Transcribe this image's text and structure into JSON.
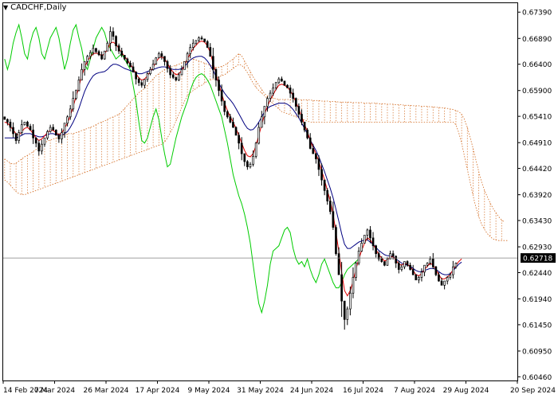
{
  "header": {
    "symbol_label": "CADCHF,Daily"
  },
  "colors": {
    "background": "#ffffff",
    "frame": "#000000",
    "bull_candle": "#ffffff",
    "bear_candle": "#000000",
    "tenkan": "#e00000",
    "kijun": "#000080",
    "chikou": "#00cc00",
    "kumo": "#d2691e",
    "current_price_line": "#808080",
    "price_box_bg": "#000000",
    "price_box_text": "#ffffff"
  },
  "chart_data": {
    "type": "candlestick",
    "instrument": "CADCHF",
    "timeframe": "Daily",
    "indicator": "Ichimoku Kinko Hyo",
    "current_price": 0.62718,
    "current_price_label": "0.62718",
    "ylim": [
      0.6039,
      0.6756
    ],
    "y_ticks": [
      "0.67390",
      "0.66890",
      "0.66400",
      "0.65900",
      "0.65410",
      "0.64910",
      "0.64420",
      "0.63920",
      "0.63430",
      "0.62930",
      "0.62440",
      "0.61940",
      "0.61450",
      "0.60950",
      "0.60460"
    ],
    "x_ticks": [
      "14 Feb 2024",
      "7 Mar 2024",
      "26 Mar 2024",
      "17 Apr 2024",
      "9 May 2024",
      "31 May 2024",
      "24 Jun 2024",
      "16 Jul 2024",
      "7 Aug 2024",
      "29 Aug 2024",
      "20 Sep 2024"
    ],
    "num_bars": 159,
    "num_slots": 180,
    "close": [
      0.6535,
      0.653,
      0.652,
      0.6508,
      0.6495,
      0.651,
      0.6525,
      0.653,
      0.6522,
      0.6515,
      0.65,
      0.649,
      0.6475,
      0.6488,
      0.65,
      0.6512,
      0.652,
      0.6515,
      0.6505,
      0.6498,
      0.651,
      0.6528,
      0.654,
      0.6555,
      0.6575,
      0.659,
      0.661,
      0.663,
      0.6645,
      0.6655,
      0.6662,
      0.667,
      0.6664,
      0.6658,
      0.665,
      0.6665,
      0.668,
      0.6702,
      0.6693,
      0.6675,
      0.6665,
      0.6657,
      0.665,
      0.6642,
      0.6635,
      0.6625,
      0.6612,
      0.6605,
      0.66,
      0.6611,
      0.6622,
      0.663,
      0.664,
      0.6652,
      0.666,
      0.6655,
      0.6645,
      0.6632,
      0.662,
      0.6615,
      0.661,
      0.662,
      0.663,
      0.6645,
      0.666,
      0.6672,
      0.668,
      0.6685,
      0.669,
      0.6688,
      0.6683,
      0.6672,
      0.6655,
      0.663,
      0.661,
      0.659,
      0.657,
      0.655,
      0.654,
      0.653,
      0.652,
      0.6505,
      0.649,
      0.647,
      0.6455,
      0.6445,
      0.645,
      0.6465,
      0.649,
      0.652,
      0.654,
      0.656,
      0.6575,
      0.6585,
      0.6595,
      0.6605,
      0.6612,
      0.6608,
      0.66,
      0.6595,
      0.6585,
      0.6575,
      0.656,
      0.6545,
      0.653,
      0.6515,
      0.65,
      0.648,
      0.647,
      0.646,
      0.644,
      0.642,
      0.64,
      0.638,
      0.636,
      0.633,
      0.628,
      0.624,
      0.619,
      0.6155,
      0.6175,
      0.6205,
      0.6235,
      0.6262,
      0.6285,
      0.63,
      0.6315,
      0.6325,
      0.631,
      0.6295,
      0.628,
      0.627,
      0.6265,
      0.6258,
      0.627,
      0.628,
      0.6275,
      0.6262,
      0.625,
      0.6255,
      0.6265,
      0.6258,
      0.625,
      0.624,
      0.623,
      0.6235,
      0.6245,
      0.6258,
      0.6262,
      0.627,
      0.6255,
      0.624,
      0.6228,
      0.622,
      0.6228,
      0.6235,
      0.624,
      0.6255,
      0.6262,
      0.627,
      0.6272
    ],
    "open_offset": 1,
    "tenkan": [
      0.653,
      0.6528,
      0.6522,
      0.6515,
      0.6508,
      0.6505,
      0.6512,
      0.6518,
      0.652,
      0.6515,
      0.6508,
      0.65,
      0.6495,
      0.6498,
      0.6504,
      0.651,
      0.6515,
      0.6514,
      0.651,
      0.6506,
      0.651,
      0.6518,
      0.6528,
      0.6542,
      0.656,
      0.6578,
      0.6598,
      0.6618,
      0.6634,
      0.6646,
      0.6654,
      0.666,
      0.6661,
      0.666,
      0.6656,
      0.666,
      0.6668,
      0.668,
      0.6682,
      0.6678,
      0.667,
      0.6662,
      0.6655,
      0.6648,
      0.664,
      0.6632,
      0.6622,
      0.6614,
      0.661,
      0.6612,
      0.6618,
      0.6626,
      0.6634,
      0.6644,
      0.6652,
      0.6654,
      0.665,
      0.6642,
      0.6632,
      0.6625,
      0.662,
      0.6622,
      0.6628,
      0.6638,
      0.665,
      0.666,
      0.667,
      0.6676,
      0.6682,
      0.6684,
      0.6682,
      0.6675,
      0.6662,
      0.6642,
      0.6622,
      0.6602,
      0.6584,
      0.6566,
      0.6552,
      0.654,
      0.653,
      0.6518,
      0.6505,
      0.649,
      0.6476,
      0.6466,
      0.6464,
      0.647,
      0.6485,
      0.6505,
      0.6525,
      0.6545,
      0.656,
      0.6572,
      0.6582,
      0.6592,
      0.66,
      0.6602,
      0.66,
      0.6596,
      0.659,
      0.658,
      0.6568,
      0.6555,
      0.654,
      0.6526,
      0.6512,
      0.6495,
      0.6482,
      0.647,
      0.6455,
      0.6438,
      0.642,
      0.64,
      0.638,
      0.6355,
      0.632,
      0.6285,
      0.6245,
      0.621,
      0.62,
      0.621,
      0.6228,
      0.625,
      0.627,
      0.6286,
      0.63,
      0.631,
      0.6306,
      0.6298,
      0.6288,
      0.6278,
      0.6272,
      0.6266,
      0.6268,
      0.6274,
      0.6274,
      0.6268,
      0.626,
      0.6258,
      0.6262,
      0.626,
      0.6255,
      0.6248,
      0.624,
      0.6238,
      0.6242,
      0.625,
      0.6256,
      0.6262,
      0.6258,
      0.625,
      0.624,
      0.6232,
      0.6232,
      0.6236,
      0.624,
      0.625,
      0.6258,
      0.6265,
      0.627
    ],
    "kijun": [
      0.65,
      0.65,
      0.65,
      0.65,
      0.65,
      0.6502,
      0.6505,
      0.6508,
      0.6508,
      0.6508,
      0.6506,
      0.6504,
      0.6502,
      0.6502,
      0.6504,
      0.6506,
      0.6508,
      0.6508,
      0.6506,
      0.6505,
      0.6505,
      0.6508,
      0.6512,
      0.652,
      0.653,
      0.6542,
      0.6556,
      0.6572,
      0.6588,
      0.66,
      0.661,
      0.6618,
      0.6622,
      0.6624,
      0.6625,
      0.6626,
      0.663,
      0.6636,
      0.664,
      0.664,
      0.6638,
      0.6635,
      0.6632,
      0.663,
      0.6628,
      0.6626,
      0.6624,
      0.6622,
      0.6622,
      0.6624,
      0.6626,
      0.6628,
      0.663,
      0.6632,
      0.6634,
      0.6635,
      0.6635,
      0.6634,
      0.6632,
      0.663,
      0.663,
      0.663,
      0.6632,
      0.6636,
      0.6642,
      0.6648,
      0.6652,
      0.6654,
      0.6655,
      0.6655,
      0.6652,
      0.6646,
      0.6638,
      0.6628,
      0.6616,
      0.6604,
      0.6594,
      0.6585,
      0.6578,
      0.6572,
      0.6565,
      0.6556,
      0.6546,
      0.6536,
      0.6526,
      0.6518,
      0.6515,
      0.6516,
      0.6522,
      0.653,
      0.654,
      0.655,
      0.6556,
      0.656,
      0.6562,
      0.6564,
      0.6566,
      0.6566,
      0.6566,
      0.6564,
      0.656,
      0.6554,
      0.6546,
      0.6538,
      0.6528,
      0.6518,
      0.6508,
      0.6496,
      0.6486,
      0.6476,
      0.6464,
      0.645,
      0.6436,
      0.642,
      0.6404,
      0.6386,
      0.6364,
      0.6342,
      0.6318,
      0.6298,
      0.629,
      0.629,
      0.6294,
      0.6298,
      0.6302,
      0.6304,
      0.6306,
      0.6306,
      0.6302,
      0.6298,
      0.6292,
      0.6286,
      0.6282,
      0.6278,
      0.6276,
      0.6276,
      0.6274,
      0.627,
      0.6266,
      0.6262,
      0.626,
      0.6258,
      0.6256,
      0.6252,
      0.6248,
      0.6246,
      0.6246,
      0.6248,
      0.625,
      0.6252,
      0.6252,
      0.625,
      0.6246,
      0.6242,
      0.624,
      0.624,
      0.6242,
      0.6248,
      0.6254,
      0.626,
      0.6264
    ],
    "chikou": [
      0.665,
      0.663,
      0.665,
      0.668,
      0.67,
      0.6715,
      0.669,
      0.666,
      0.665,
      0.668,
      0.67,
      0.671,
      0.669,
      0.666,
      0.665,
      0.667,
      0.669,
      0.67,
      0.671,
      0.669,
      0.666,
      0.663,
      0.665,
      0.668,
      0.6705,
      0.6715,
      0.669,
      0.667,
      0.664,
      0.663,
      0.665,
      0.667,
      0.669,
      0.67,
      0.671,
      0.67,
      0.668,
      0.667,
      0.666,
      0.665,
      0.6655,
      0.666,
      0.665,
      0.664,
      0.663,
      0.66,
      0.657,
      0.653,
      0.6495,
      0.649,
      0.65,
      0.652,
      0.654,
      0.6555,
      0.6535,
      0.65,
      0.647,
      0.6445,
      0.645,
      0.6475,
      0.65,
      0.652,
      0.654,
      0.6555,
      0.657,
      0.659,
      0.6605,
      0.6615,
      0.662,
      0.6622,
      0.6618,
      0.661,
      0.66,
      0.6585,
      0.657,
      0.6555,
      0.654,
      0.6515,
      0.649,
      0.646,
      0.643,
      0.641,
      0.639,
      0.6375,
      0.6355,
      0.633,
      0.63,
      0.626,
      0.622,
      0.6185,
      0.6168,
      0.619,
      0.622,
      0.626,
      0.6285,
      0.629,
      0.6295,
      0.631,
      0.6325,
      0.633,
      0.632,
      0.629,
      0.627,
      0.626,
      0.6265,
      0.6255,
      0.627,
      0.625,
      0.6235,
      0.6225,
      0.624,
      0.626,
      0.627,
      0.6255,
      0.624,
      0.6225,
      0.6215,
      0.6215,
      0.6225,
      0.624,
      0.625,
      0.6255,
      0.626,
      0.6265,
      0.627
    ],
    "kumo_upper": [
      0.646,
      0.6456,
      0.6452,
      0.645,
      0.6452,
      0.6456,
      0.646,
      0.6464,
      0.6467,
      0.647,
      0.6474,
      0.6478,
      0.6482,
      0.6486,
      0.649,
      0.6494,
      0.6496,
      0.6498,
      0.65,
      0.6502,
      0.6504,
      0.6506,
      0.6508,
      0.6508,
      0.6508,
      0.651,
      0.6512,
      0.6514,
      0.6516,
      0.6518,
      0.652,
      0.6522,
      0.6525,
      0.6528,
      0.653,
      0.6532,
      0.6535,
      0.6538,
      0.654,
      0.6542,
      0.6545,
      0.655,
      0.6556,
      0.6562,
      0.6568,
      0.6574,
      0.658,
      0.6586,
      0.659,
      0.6594,
      0.66,
      0.6606,
      0.6612,
      0.6618,
      0.6622,
      0.6626,
      0.663,
      0.6632,
      0.6634,
      0.6636,
      0.6638,
      0.664,
      0.6643,
      0.6646,
      0.6648,
      0.665,
      0.665,
      0.6648,
      0.6646,
      0.6644,
      0.6642,
      0.664,
      0.6638,
      0.6636,
      0.6634,
      0.6634,
      0.6636,
      0.6638,
      0.6642,
      0.6646,
      0.665,
      0.6655,
      0.666,
      0.6656,
      0.6646,
      0.6636,
      0.6626,
      0.6616,
      0.6608,
      0.66,
      0.6592,
      0.6584,
      0.658,
      0.6578,
      0.6576,
      0.6574,
      0.6573,
      0.6573,
      0.6573,
      0.6573,
      0.6573,
      0.6573,
      0.6573,
      0.6573,
      0.6572,
      0.6572,
      0.6572,
      0.6572,
      0.6571,
      0.6571,
      0.6571,
      0.657,
      0.657,
      0.657,
      0.6569,
      0.6569,
      0.6569,
      0.6568,
      0.6568,
      0.6568,
      0.6568,
      0.6568,
      0.6567,
      0.6567,
      0.6567,
      0.6567,
      0.6566,
      0.6566,
      0.6566,
      0.6566,
      0.6566,
      0.6565,
      0.6565,
      0.6565,
      0.6564,
      0.6564,
      0.6564,
      0.6563,
      0.6563,
      0.6563,
      0.6562,
      0.6562,
      0.6562,
      0.6561,
      0.6561,
      0.6561,
      0.656,
      0.656,
      0.656,
      0.6559,
      0.6559,
      0.6558,
      0.6558,
      0.6557,
      0.6557,
      0.6556,
      0.6555,
      0.6554,
      0.6552,
      0.655,
      0.6545,
      0.6535,
      0.652,
      0.65,
      0.648,
      0.6458,
      0.6436,
      0.6416,
      0.64,
      0.6388,
      0.6376,
      0.6366,
      0.6358,
      0.635,
      0.6344,
      0.634
    ],
    "kumo_lower": [
      0.642,
      0.6416,
      0.641,
      0.6404,
      0.6398,
      0.6394,
      0.6392,
      0.6392,
      0.6394,
      0.6396,
      0.6398,
      0.64,
      0.6402,
      0.6404,
      0.6406,
      0.6408,
      0.641,
      0.6412,
      0.6414,
      0.6416,
      0.6418,
      0.642,
      0.6422,
      0.6424,
      0.6426,
      0.6428,
      0.643,
      0.6432,
      0.6434,
      0.6436,
      0.6438,
      0.644,
      0.6442,
      0.6444,
      0.6446,
      0.6448,
      0.645,
      0.6452,
      0.6454,
      0.6456,
      0.6458,
      0.646,
      0.6462,
      0.6464,
      0.6466,
      0.6468,
      0.647,
      0.6472,
      0.6474,
      0.6476,
      0.6478,
      0.648,
      0.6482,
      0.6484,
      0.6486,
      0.6488,
      0.6492,
      0.65,
      0.651,
      0.652,
      0.6532,
      0.6545,
      0.6558,
      0.657,
      0.658,
      0.6586,
      0.659,
      0.6594,
      0.6598,
      0.66,
      0.6604,
      0.6608,
      0.661,
      0.6612,
      0.6614,
      0.6616,
      0.6618,
      0.662,
      0.6624,
      0.6628,
      0.6632,
      0.6636,
      0.664,
      0.6638,
      0.6632,
      0.6624,
      0.6614,
      0.6604,
      0.6596,
      0.659,
      0.6585,
      0.658,
      0.6575,
      0.657,
      0.6565,
      0.656,
      0.6555,
      0.655,
      0.6548,
      0.6546,
      0.6544,
      0.6542,
      0.654,
      0.6538,
      0.6536,
      0.6534,
      0.6532,
      0.653,
      0.653,
      0.653,
      0.653,
      0.653,
      0.653,
      0.653,
      0.653,
      0.653,
      0.653,
      0.653,
      0.653,
      0.653,
      0.653,
      0.653,
      0.653,
      0.653,
      0.653,
      0.653,
      0.653,
      0.653,
      0.653,
      0.653,
      0.653,
      0.653,
      0.653,
      0.653,
      0.653,
      0.653,
      0.653,
      0.653,
      0.653,
      0.653,
      0.653,
      0.653,
      0.653,
      0.653,
      0.653,
      0.653,
      0.653,
      0.653,
      0.653,
      0.653,
      0.653,
      0.653,
      0.653,
      0.653,
      0.653,
      0.653,
      0.653,
      0.653,
      0.6525,
      0.651,
      0.649,
      0.6465,
      0.644,
      0.6415,
      0.639,
      0.6368,
      0.635,
      0.6336,
      0.6326,
      0.6318,
      0.6312,
      0.6308,
      0.6306,
      0.6305,
      0.6305,
      0.6305,
      0.6305
    ]
  }
}
